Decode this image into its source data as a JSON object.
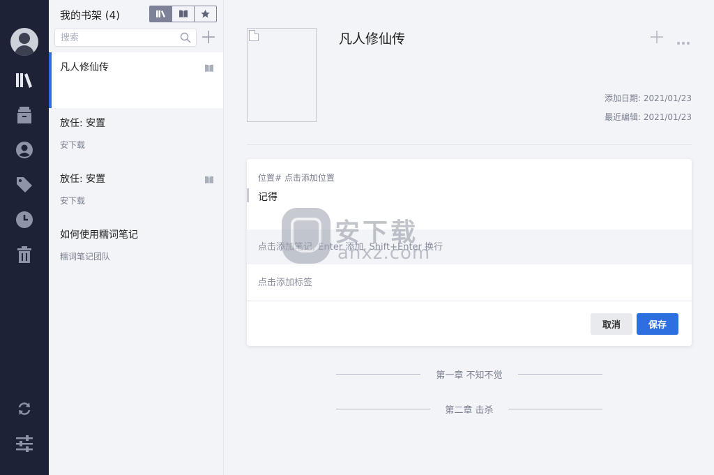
{
  "shelf": {
    "title": "我的书架 (4)",
    "search_placeholder": "搜索",
    "view_modes": [
      "library-view",
      "book-view",
      "favorite-view"
    ]
  },
  "books": [
    {
      "title": "凡人修仙传",
      "author": "",
      "active": true,
      "icon": "book-open-icon"
    },
    {
      "title": "放任: 安置",
      "author": "安下载",
      "active": false,
      "icon": ""
    },
    {
      "title": "放任: 安置",
      "author": "安下载",
      "active": false,
      "icon": "book-open-icon"
    },
    {
      "title": "如何使用糯词笔记",
      "author": "糯词笔记团队",
      "active": false,
      "icon": ""
    }
  ],
  "detail": {
    "title": "凡人修仙传",
    "added_label": "添加日期: 2021/01/23",
    "edited_label": "最近编辑: 2021/01/23"
  },
  "note": {
    "location": "位置# 点击添加位置",
    "quote": "记得",
    "note_placeholder": "点击添加笔记, Enter 添加, Shift+Enter 换行",
    "tag_placeholder": "点击添加标签",
    "cancel_label": "取消",
    "save_label": "保存"
  },
  "chapters": [
    "第一章 不知不觉",
    "第二章 击杀"
  ],
  "watermark": {
    "big": "安下载",
    "small": "anxz.com"
  },
  "colors": {
    "rail": "#1d2236",
    "accent": "#2e6fe0",
    "toggle": "#7d8299"
  }
}
